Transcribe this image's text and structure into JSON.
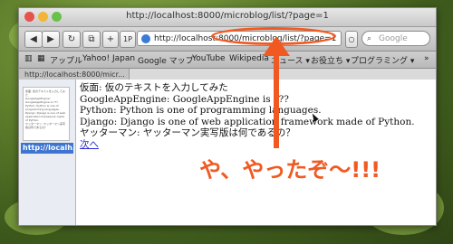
{
  "window": {
    "title": "http://localhost:8000/microblog/list/?page=1"
  },
  "toolbar": {
    "back": "◀",
    "forward": "▶",
    "reload": "↻",
    "new_tab": "+",
    "url": "http://localhost:8000/microblog/list/?page=1",
    "search_placeholder": "Google"
  },
  "bookmarks": [
    "アップル",
    "Yahoo! Japan",
    "Google マップ",
    "YouTube",
    "Wikipedia",
    "ニュース ▾",
    "お役立ち ▾",
    "プログラミング ▾"
  ],
  "tab": {
    "label": "http://localhost:8000/micr..."
  },
  "sidebar": {
    "selected_label": "http://localh..."
  },
  "content": {
    "lines": [
      "仮面: 仮のテキストを入力してみた",
      "GoogleAppEngine: GoogleAppEngine is ???",
      "Python: Python is one of programming languages.",
      "Django: Django is one of web application framework made of Python.",
      "ヤッターマン: ヤッターマン実写版は何であるの？"
    ],
    "next_link": "次へ"
  },
  "annotation": {
    "banner": "や、やったぞ〜!!!",
    "color": "#f05a22"
  }
}
